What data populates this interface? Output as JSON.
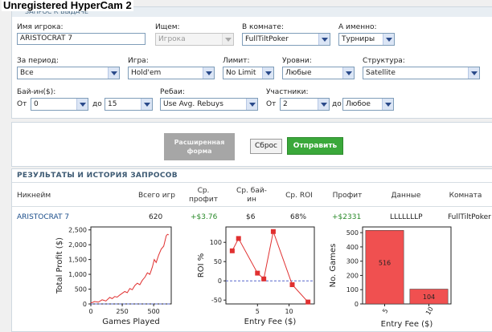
{
  "app": {
    "watermark": "Unregistered HyperCam 2"
  },
  "search_form": {
    "header": "ЗАПРОС К ВЫДАЧЕ",
    "player_name": {
      "label": "Имя игрока:",
      "value": "ARISTOCRAT 7"
    },
    "search_for": {
      "label": "Ищем:",
      "value": "Игрока"
    },
    "room": {
      "label": "В комнате:",
      "value": "FullTiltPoker"
    },
    "namely": {
      "label": "А именно:",
      "value": "Турниры"
    },
    "period": {
      "label": "За период:",
      "value": "Все"
    },
    "game": {
      "label": "Игра:",
      "value": "Hold'em"
    },
    "limit": {
      "label": "Лимит:",
      "value": "No Limit"
    },
    "levels": {
      "label": "Уровни:",
      "value": "Любые"
    },
    "structure": {
      "label": "Структура:",
      "value": "Satellite"
    },
    "buyin": {
      "label": "Бай-ин($):",
      "from_label": "От",
      "from": "0",
      "to_label": "до",
      "to": "15"
    },
    "rebuys": {
      "label": "Ребаи:",
      "value": "Use Avg. Rebuys"
    },
    "participants": {
      "label": "Участники:",
      "from_label": "От",
      "from": "2",
      "to_label": "до",
      "to": "Любое"
    }
  },
  "buttons": {
    "advanced": "Расширенная форма",
    "reset": "Сброс",
    "submit": "Отправить"
  },
  "results": {
    "title": "РЕЗУЛЬТАТЫ И ИСТОРИЯ ЗАПРОСОВ",
    "columns": [
      "Никнейм",
      "Всего игр",
      "Ср. профит",
      "Ср. бай-ин",
      "Ср. ROI",
      "Профит",
      "Данные",
      "Комната"
    ],
    "row": {
      "nickname": "ARISTOCRAT 7",
      "games": "620",
      "avg_profit": "+$3.76",
      "avg_buyin": "$6",
      "avg_roi": "68%",
      "profit": "+$2331",
      "data": "LLLLLLLP",
      "room": "FullTiltPoker"
    },
    "colors": {
      "green": "#2a8a2a",
      "link": "#1a4d8a"
    }
  },
  "chart_data": [
    {
      "type": "line",
      "xlabel": "Games Played",
      "ylabel": "Total Profit ($)",
      "xlim": [
        0,
        640
      ],
      "ylim": [
        0,
        2600
      ],
      "xticks": [
        0,
        250,
        500
      ],
      "yticks": [
        0,
        500,
        1000,
        1500,
        2000,
        2500
      ],
      "ytick_labels": [
        "0",
        "500",
        "1,000",
        "1,500",
        "2,000",
        "2,500"
      ],
      "reference_line": 0,
      "series": [
        {
          "color": "#e03030",
          "x": [
            0,
            30,
            60,
            90,
            120,
            150,
            170,
            190,
            210,
            230,
            250,
            270,
            290,
            310,
            330,
            350,
            370,
            390,
            410,
            430,
            450,
            470,
            490,
            505,
            520,
            540,
            560,
            580,
            600,
            610,
            620
          ],
          "y": [
            30,
            80,
            60,
            140,
            100,
            220,
            180,
            250,
            230,
            300,
            360,
            420,
            380,
            520,
            480,
            620,
            700,
            650,
            800,
            900,
            1050,
            1000,
            1250,
            1500,
            1400,
            1650,
            1850,
            1950,
            2300,
            2350,
            2331
          ]
        }
      ]
    },
    {
      "type": "line",
      "xlabel": "Entry Fee ($)",
      "ylabel": "ROI %",
      "xlim": [
        0,
        14
      ],
      "ylim": [
        -60,
        140
      ],
      "xticks": [
        5,
        10
      ],
      "yticks": [
        -50,
        0,
        50,
        100
      ],
      "reference_line": 0,
      "series": [
        {
          "color": "#e03030",
          "x": [
            1,
            2,
            5,
            6,
            7.5,
            10.5,
            13
          ],
          "y": [
            78,
            110,
            20,
            5,
            128,
            -10,
            -55
          ]
        }
      ]
    },
    {
      "type": "bar",
      "xlabel": "Entry Fee ($)",
      "ylabel": "No. Games",
      "categories": [
        "5",
        "10"
      ],
      "values": [
        516,
        104
      ],
      "ylim": [
        0,
        540
      ],
      "yticks": [
        0,
        100,
        200,
        300,
        400,
        500
      ],
      "color": "#f05050"
    }
  ]
}
